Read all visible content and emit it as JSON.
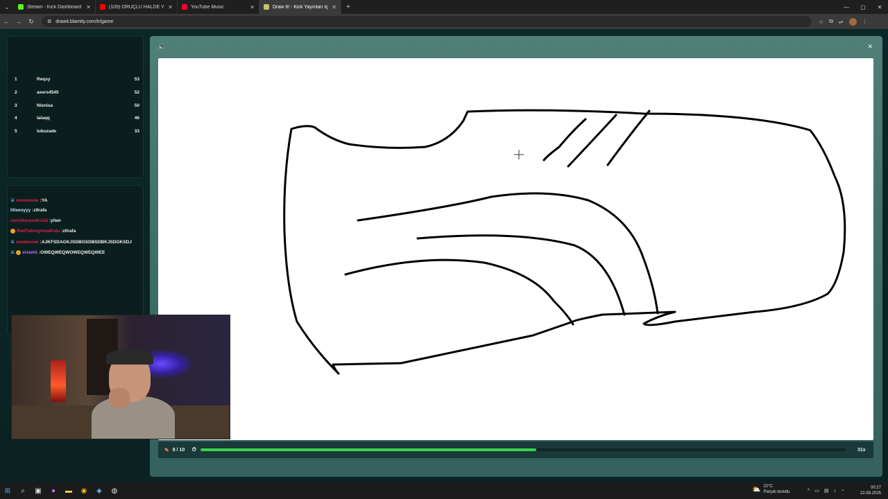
{
  "browser": {
    "tabs": [
      {
        "title": "Stream - Kick Dashboard",
        "color": "#53fc18",
        "active": false
      },
      {
        "title": "(109) ORUÇLU HALDE YORMA…",
        "color": "#ff0000",
        "active": false
      },
      {
        "title": "YouTube Music",
        "color": "#ff0033",
        "active": false
      },
      {
        "title": "Draw It! - Kick Yayınları İçin Çizi…",
        "color": "#c9c36a",
        "active": true
      }
    ],
    "url": "drawit.blamity.com/tr/game"
  },
  "leaderboard": [
    {
      "rank": "1",
      "name": "Reqsy",
      "score": "53"
    },
    {
      "rank": "2",
      "name": "axers4545",
      "score": "52"
    },
    {
      "rank": "3",
      "name": "Nisnisa",
      "score": "50"
    },
    {
      "rank": "4",
      "name": "lalaqq",
      "score": "46"
    },
    {
      "rank": "5",
      "name": "lubuzade",
      "score": "33"
    }
  ],
  "chat": [
    {
      "user": "wonkeswe",
      "text": ":YA",
      "color": "#e0204a",
      "badge": "sword"
    },
    {
      "user": "lilleeoyyy",
      "text": ":z0rafa",
      "color": "#bfe3ff",
      "badge": ""
    },
    {
      "user": "ramizkaraseksi18",
      "text": ":yilan",
      "color": "#e0204a",
      "badge": ""
    },
    {
      "user": "RedTukergAmaKutu",
      "text": ":z0rafa",
      "color": "#e0204a",
      "badge": "gold"
    },
    {
      "user": "wonkeswe",
      "text": ":AJKFSDAGKJSDBGSDBSDBKJSDGKSDJ",
      "color": "#e0204a",
      "badge": "sword"
    },
    {
      "user": "elslekk",
      "text": ":OWEQWEQWOWEQWEQWEE",
      "color": "#b06cff",
      "badge": "sword-gold"
    }
  ],
  "game": {
    "round": "8 / 10",
    "progress": 0.52,
    "seconds": "31s",
    "accent": "#38d44a"
  },
  "taskbar": {
    "weather_temp": "22°C",
    "weather_desc": "Parçalı bulutlu",
    "time": "00:27",
    "date": "22.08.2025"
  }
}
